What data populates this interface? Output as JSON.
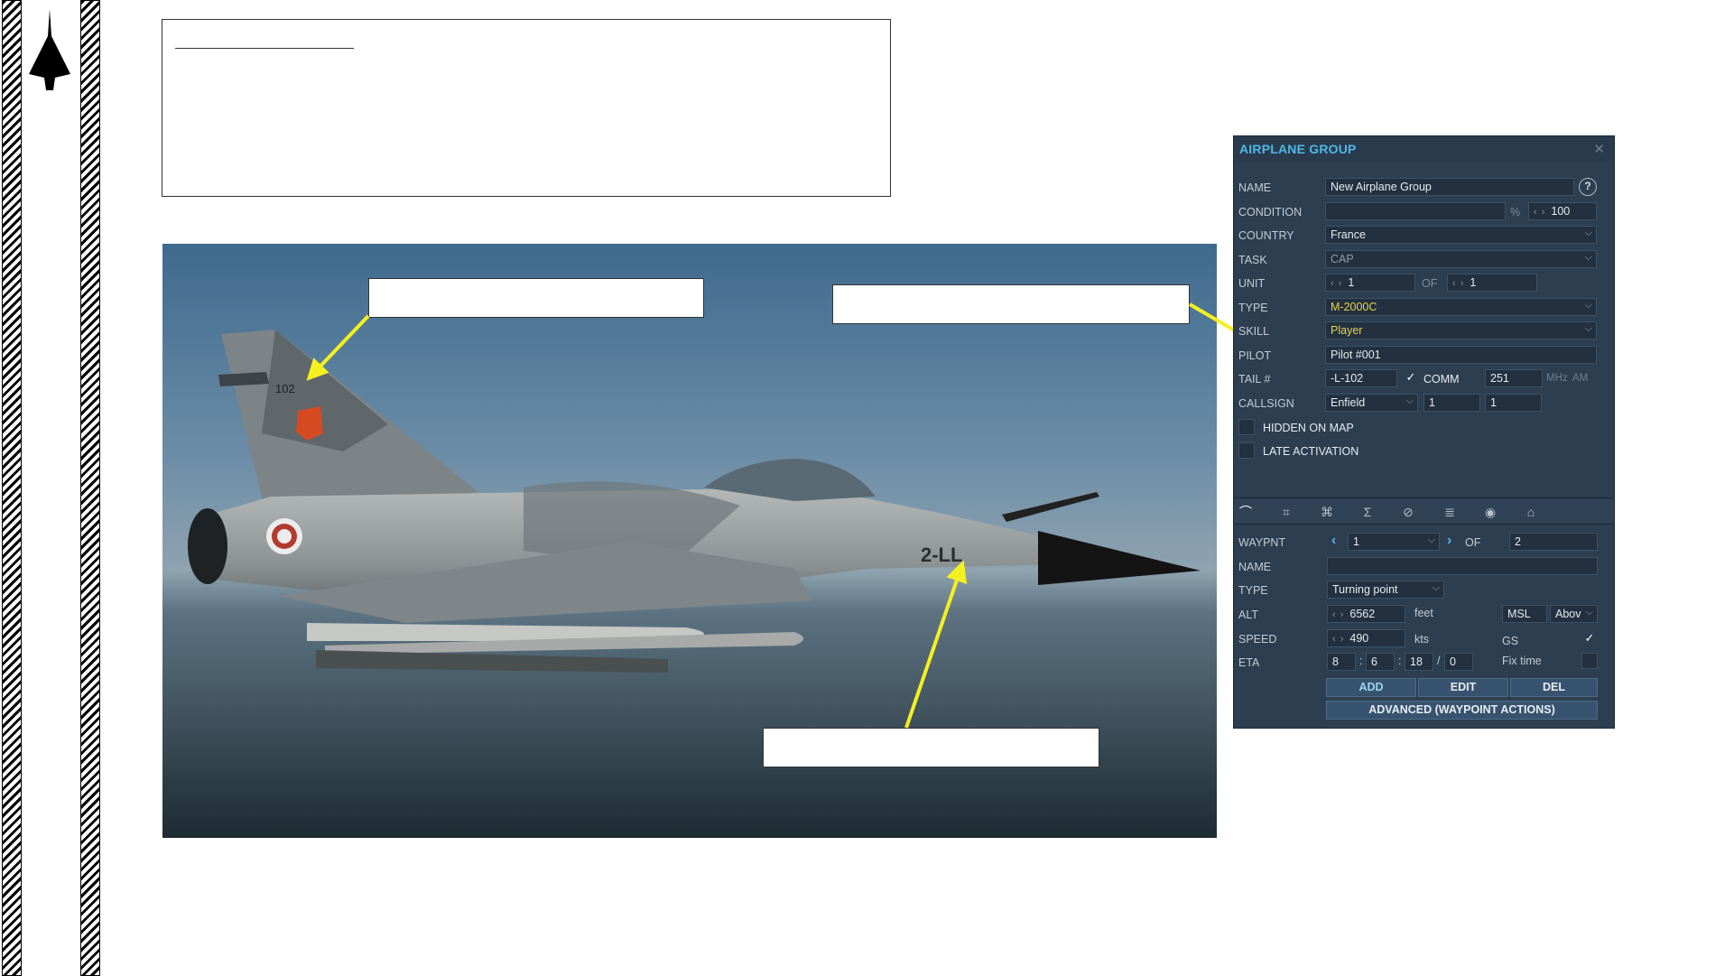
{
  "panel": {
    "title": "AIRPLANE GROUP",
    "close_icon": "close-icon",
    "help_label": "?",
    "name": {
      "label": "NAME",
      "value": "New Airplane Group"
    },
    "condition": {
      "label": "CONDITION",
      "value": "",
      "percent_sign": "%",
      "spinner_value": "100"
    },
    "country": {
      "label": "COUNTRY",
      "value": "France"
    },
    "task": {
      "label": "TASK",
      "value": "CAP"
    },
    "unit": {
      "label": "UNIT",
      "value": "1",
      "of_label": "OF",
      "total": "1"
    },
    "type": {
      "label": "TYPE",
      "value": "M-2000C"
    },
    "skill": {
      "label": "SKILL",
      "value": "Player"
    },
    "pilot": {
      "label": "PILOT",
      "value": "Pilot #001"
    },
    "tail": {
      "label": "TAIL #",
      "value": "-L-102",
      "comm_label": "COMM",
      "comm_value": "251",
      "mhz_label": "MHz",
      "am_label": "AM",
      "comm_checked": true
    },
    "callsign": {
      "label": "CALLSIGN",
      "value": "Enfield",
      "num1": "1",
      "num2": "1"
    },
    "hidden_on_map": {
      "label": "HIDDEN ON MAP",
      "checked": false
    },
    "late_activation": {
      "label": "LATE ACTIVATION",
      "checked": false
    },
    "tabs": [
      "route-icon",
      "triggered-actions-icon",
      "targets-icon",
      "summary-icon",
      "failures-icon",
      "payload-icon",
      "radio-icon",
      "aircraft-icon"
    ],
    "waypoint": {
      "label": "WAYPNT",
      "value": "1",
      "of_label": "OF",
      "total": "2",
      "name_label": "NAME",
      "name_value": "",
      "type_label": "TYPE",
      "type_value": "Turning point",
      "alt_label": "ALT",
      "alt_value": "6562",
      "alt_unit": "feet",
      "alt_ref": "MSL",
      "alt_ref2": "Abov",
      "speed_label": "SPEED",
      "speed_value": "490",
      "speed_unit": "kts",
      "gs_label": "GS",
      "gs_checked": true,
      "eta_label": "ETA",
      "eta_d": "8",
      "eta_h": "6",
      "eta_m": "18",
      "eta_s": "0",
      "fix_time_label": "Fix time",
      "fix_time_checked": false
    },
    "buttons": {
      "add": "ADD",
      "edit": "EDIT",
      "del": "DEL",
      "advanced": "ADVANCED (WAYPOINT ACTIONS)"
    }
  },
  "photo": {
    "tail_number": "102",
    "nose_code": "2-LL"
  },
  "colors": {
    "panel_bg": "#2c3e50",
    "panel_title": "#4fb8e6",
    "arrow": "#f4f020",
    "type_value": "#e6d44a"
  }
}
